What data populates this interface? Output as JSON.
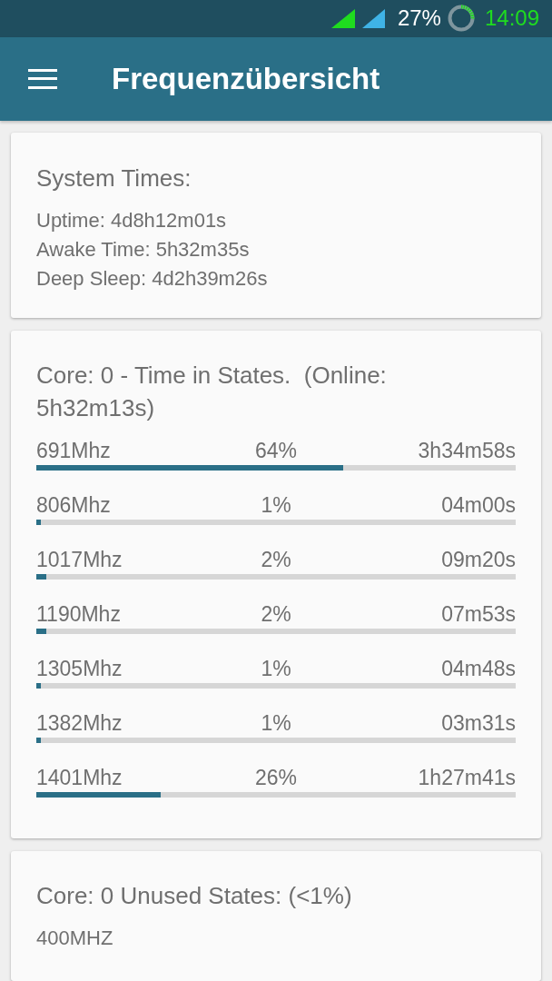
{
  "status_bar": {
    "battery": "27%",
    "time": "14:09"
  },
  "app_bar": {
    "title": "Frequenzübersicht"
  },
  "system_times": {
    "title": "System Times:",
    "lines": [
      "Uptime: 4d8h12m01s",
      "Awake Time: 5h32m35s",
      "Deep Sleep: 4d2h39m26s"
    ]
  },
  "time_in_states": {
    "title": "Core: 0 - Time in States.  (Online: 5h32m13s)",
    "rows": [
      {
        "frequency": "691Mhz",
        "percent": "64%",
        "time": "3h34m58s",
        "level": 0.64
      },
      {
        "frequency": "806Mhz",
        "percent": "1%",
        "time": "04m00s",
        "level": 0.01
      },
      {
        "frequency": "1017Mhz",
        "percent": "2%",
        "time": "09m20s",
        "level": 0.02
      },
      {
        "frequency": "1190Mhz",
        "percent": "2%",
        "time": "07m53s",
        "level": 0.02
      },
      {
        "frequency": "1305Mhz",
        "percent": "1%",
        "time": "04m48s",
        "level": 0.01
      },
      {
        "frequency": "1382Mhz",
        "percent": "1%",
        "time": "03m31s",
        "level": 0.01
      },
      {
        "frequency": "1401Mhz",
        "percent": "26%",
        "time": "1h27m41s",
        "level": 0.26
      }
    ]
  },
  "unused_states": {
    "title": "Core: 0 Unused States: (<1%)",
    "items": [
      "400MHZ"
    ]
  }
}
